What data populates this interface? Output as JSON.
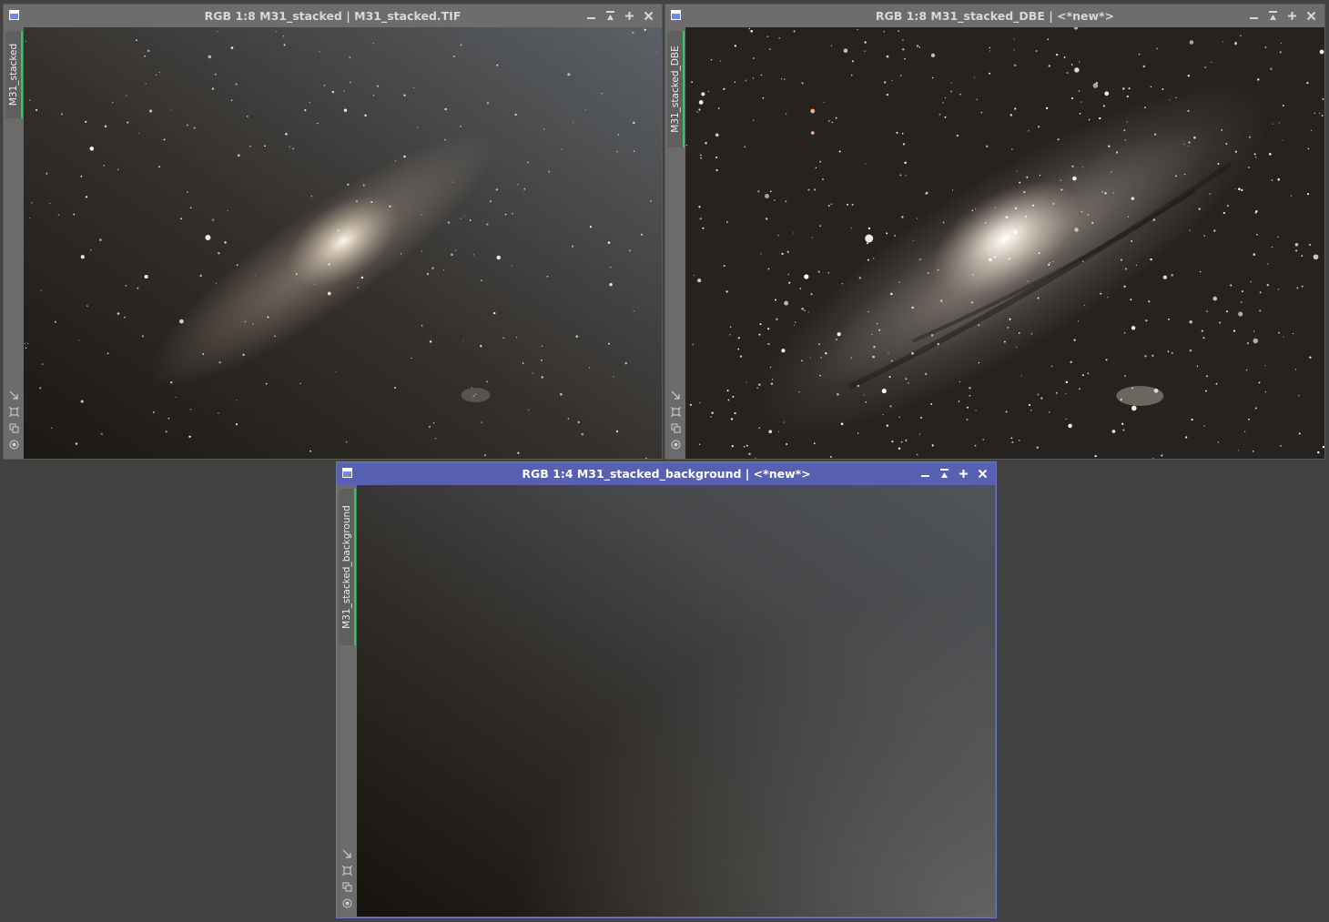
{
  "windows": {
    "original": {
      "title": "RGB 1:8 M31_stacked | M31_stacked.TIF",
      "tab_label": "M31_stacked"
    },
    "dbe": {
      "title": "RGB 1:8 M31_stacked_DBE | <*new*>",
      "tab_label": "M31_stacked_DBE"
    },
    "background": {
      "title": "RGB 1:4 M31_stacked_background | <*new*>",
      "tab_label": "M31_stacked_background"
    }
  },
  "icons": {
    "controls": [
      "minimize-icon",
      "shade-icon",
      "maximize-icon",
      "close-icon"
    ],
    "tools": [
      "auto-stretch-icon",
      "fit-view-icon",
      "clone-icon",
      "mask-icon"
    ]
  },
  "colors": {
    "active_titlebar": "#5860b2",
    "inactive_titlebar": "#6d6d6d",
    "tab_accent": "#2ecb5c",
    "desktop": "#424242"
  }
}
